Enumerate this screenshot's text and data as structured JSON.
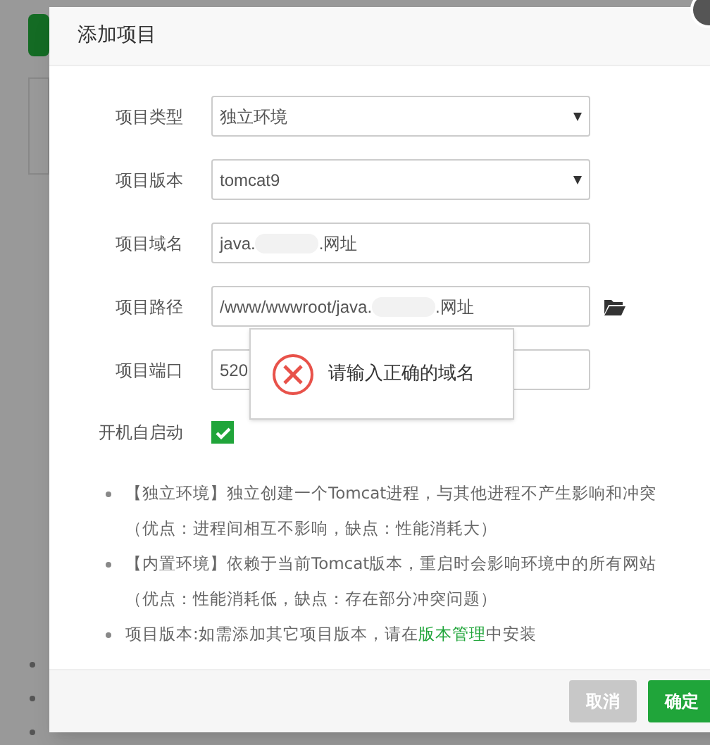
{
  "dialog": {
    "title": "添加项目"
  },
  "fields": [
    {
      "kind": "select",
      "label": "项目类型",
      "value": "独立环境"
    },
    {
      "kind": "select",
      "label": "项目版本",
      "value": "tomcat9"
    },
    {
      "kind": "text",
      "label": "项目域名",
      "value_start": "java.",
      "value_end": ".网址"
    },
    {
      "kind": "path",
      "label": "项目路径",
      "value_start": "/www/wwwroot/java.",
      "value_end": ".网址"
    },
    {
      "kind": "text",
      "label": "项目端口",
      "value_start": "520"
    }
  ],
  "autostart": {
    "label": "开机自启动",
    "checked": true
  },
  "notes": [
    {
      "text": "【独立环境】独立创建一个Tomcat进程，与其他进程不产生影响和冲突（优点：进程间相互不影响，缺点：性能消耗大）"
    },
    {
      "text": "【内置环境】依赖于当前Tomcat版本，重启时会影响环境中的所有网站（优点：性能消耗低，缺点：存在部分冲突问题）"
    },
    {
      "text": "项目版本:如需添加其它项目版本，请在",
      "link": "版本管理",
      "after": "中安装"
    }
  ],
  "error_popup": {
    "message": "请输入正确的域名"
  },
  "buttons": [
    {
      "label": "取消",
      "kind": "secondary"
    },
    {
      "label": "确定",
      "kind": "primary"
    }
  ]
}
